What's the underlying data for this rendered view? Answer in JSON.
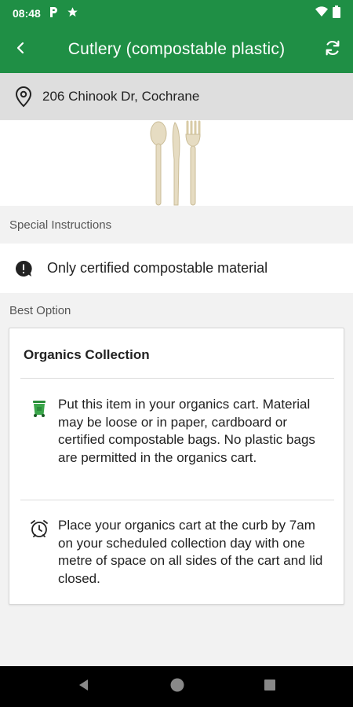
{
  "status_bar": {
    "time": "08:48",
    "icons": [
      "parking-icon",
      "star-icon",
      "wifi-icon",
      "battery-icon"
    ]
  },
  "app_bar": {
    "title": "Cutlery (compostable plastic)",
    "back_icon": "back-chevron-icon",
    "refresh_icon": "refresh-icon"
  },
  "address": {
    "icon": "location-pin-icon",
    "text": "206 Chinook Dr, Cochrane"
  },
  "hero": {
    "image": "cutlery-icon"
  },
  "special_instructions": {
    "label": "Special Instructions",
    "items": [
      {
        "icon": "alert-bubble-icon",
        "text": "Only certified compostable material"
      }
    ]
  },
  "best_option": {
    "label": "Best Option",
    "card": {
      "title": "Organics Collection",
      "rows": [
        {
          "icon": "organics-cart-icon",
          "text": "Put this item in your organics cart. Material may be loose or in paper, cardboard or certified compostable bags.  No plastic bags are permitted in the organics cart."
        },
        {
          "icon": "alarm-clock-icon",
          "text": "Place your organics cart at the curb by 7am on your scheduled collection day with one metre of space on all sides of the cart and lid closed."
        }
      ]
    }
  },
  "colors": {
    "brand_green": "#1f8f45",
    "address_bg": "#dedede",
    "page_bg": "#f2f2f2"
  }
}
